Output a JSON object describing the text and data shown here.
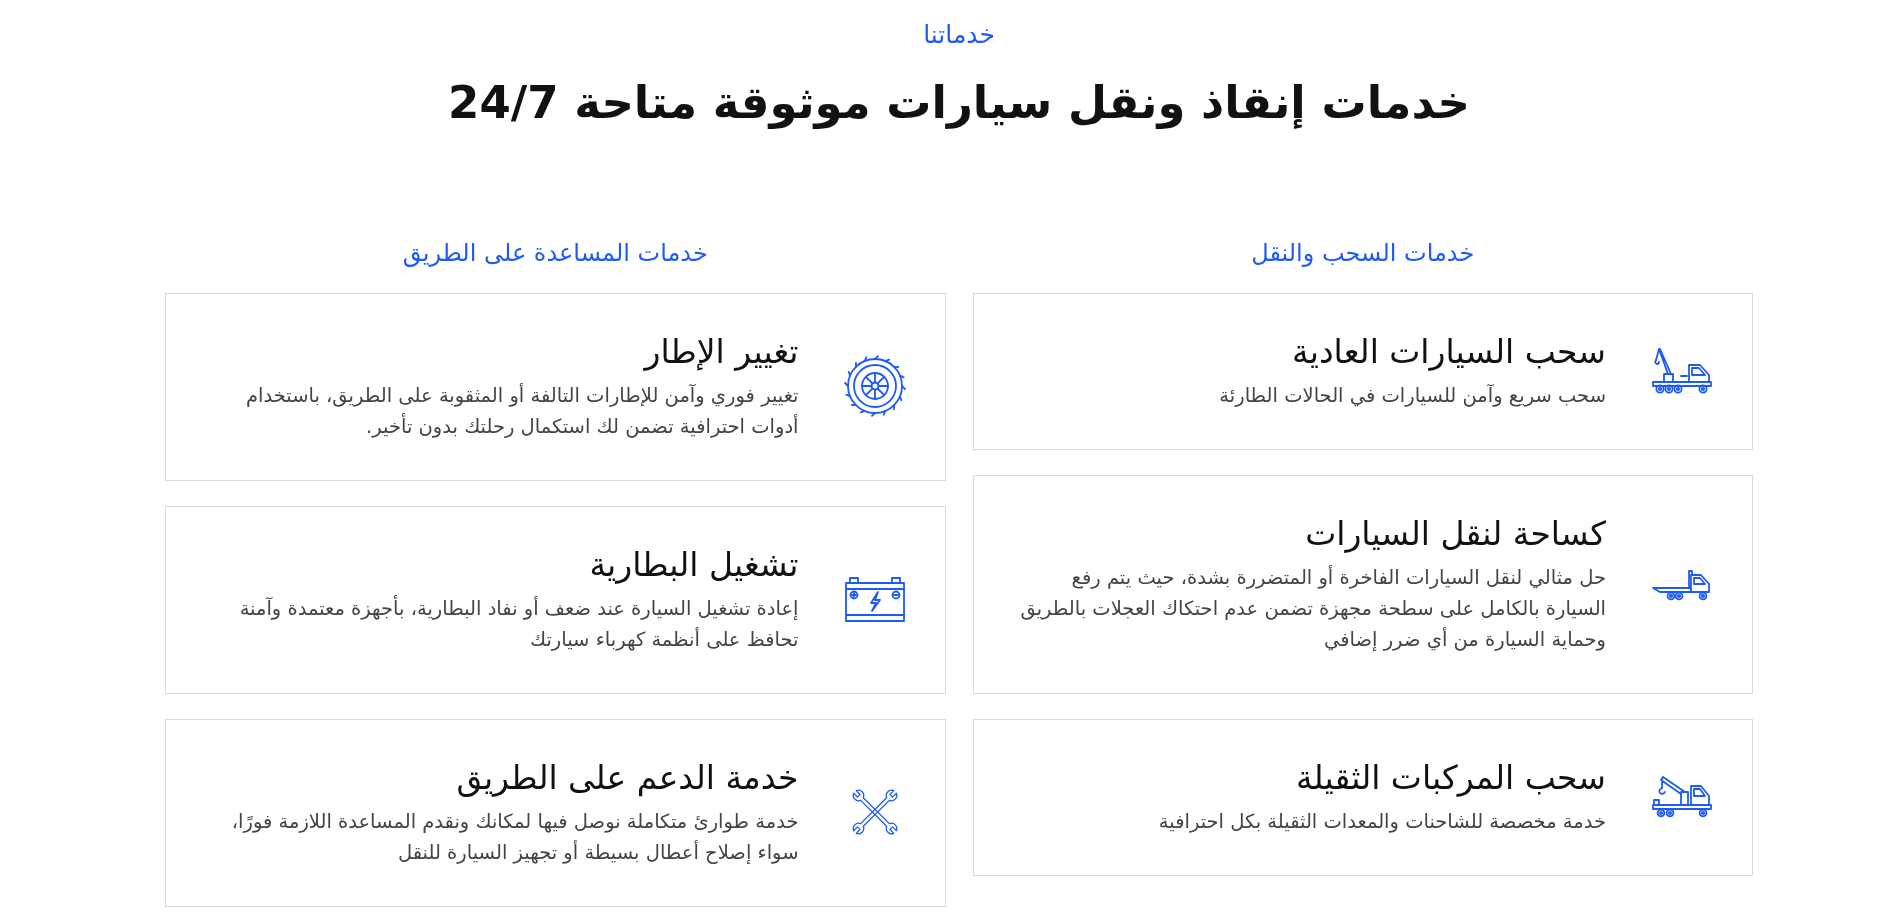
{
  "section": {
    "eyebrow": "خدماتنا",
    "title": "خدمات إنقاذ ونقل سيارات موثوقة متاحة 24/7"
  },
  "columns": [
    {
      "heading": "خدمات السحب والنقل",
      "services": [
        {
          "kind": "towtruck",
          "title": "سحب السيارات العادية",
          "description": "سحب سريع وآمن للسيارات في الحالات الطارئة"
        },
        {
          "kind": "flatbed",
          "title": "كساحة لنقل السيارات",
          "description": "حل مثالي لنقل السيارات الفاخرة أو المتضررة بشدة، حيث يتم رفع السيارة بالكامل على سطحة مجهزة تضمن عدم احتكاك العجلات بالطريق وحماية السيارة من أي ضرر إضافي"
        },
        {
          "kind": "crane",
          "title": "سحب المركبات الثقيلة",
          "description": "خدمة مخصصة للشاحنات والمعدات الثقيلة بكل احترافية"
        }
      ]
    },
    {
      "heading": "خدمات المساعدة على الطريق",
      "services": [
        {
          "kind": "tire",
          "title": "تغيير الإطار",
          "description": "تغيير فوري وآمن للإطارات التالفة أو المثقوبة على الطريق، باستخدام أدوات احترافية تضمن لك استكمال رحلتك بدون تأخير."
        },
        {
          "kind": "battery",
          "title": "تشغيل البطارية",
          "description": "إعادة تشغيل السيارة عند ضعف أو نفاد البطارية، بأجهزة معتمدة وآمنة تحافظ على أنظمة كهرباء سيارتك"
        },
        {
          "kind": "wrenches",
          "title": "خدمة الدعم على الطريق",
          "description": "خدمة طوارئ متكاملة نوصل فيها لمكانك ونقدم المساعدة اللازمة فورًا، سواء إصلاح أعطال بسيطة أو تجهيز السيارة للنقل"
        }
      ]
    }
  ]
}
